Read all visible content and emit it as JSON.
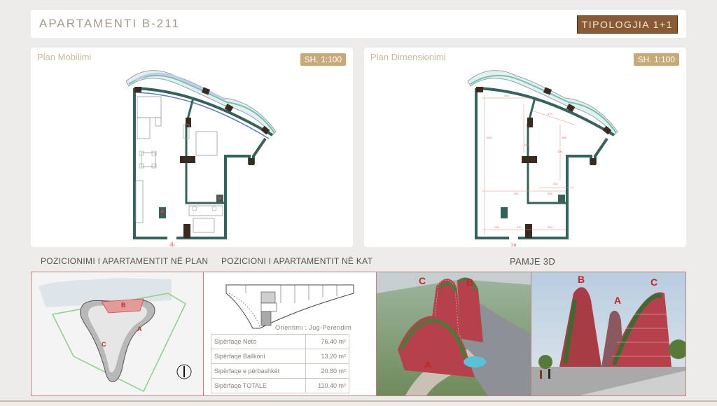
{
  "header": {
    "title": "APARTAMENTI B-211",
    "typology": "TIPOLOGJIA 1+1"
  },
  "plans": [
    {
      "title": "Plan Mobilimi",
      "scale": "SH. 1:100",
      "marker": "211"
    },
    {
      "title": "Plan Dimensionimi",
      "scale": "SH. 1:100",
      "marker": "211"
    }
  ],
  "dimensions": [
    "410",
    "270",
    "396",
    "1067",
    "361",
    "206",
    "270",
    "145",
    "230",
    "166",
    "170",
    "206"
  ],
  "sections": {
    "plan_position": "POZICIONIMI I APARTAMENTIT NË PLAN",
    "floor_position": "POZICIONI I APARTAMENTIT NË KAT",
    "view_3d": "PAMJE 3D"
  },
  "orientation": "Orientimi : Jug-Perendim",
  "areas": [
    {
      "label": "Sipërfaqe Neto",
      "value": "76.40",
      "unit": "m²"
    },
    {
      "label": "Sipërfaqe Ballkoni",
      "value": "13.20",
      "unit": "m²"
    },
    {
      "label": "Sipërfaqe e përbashkët",
      "value": "20.80",
      "unit": "m²"
    },
    {
      "label": "Sipërfaqe TOTALE",
      "value": "110.40",
      "unit": "m²"
    }
  ],
  "site_labels": [
    "A",
    "B",
    "C"
  ],
  "render1_labels": [
    "C",
    "B",
    "A"
  ],
  "render2_labels": [
    "B",
    "A",
    "C"
  ],
  "colors": {
    "accent_brown": "#8a5a35",
    "scale_badge": "#c8aa78",
    "wall": "#35625a",
    "building_red": "#b5414c"
  }
}
